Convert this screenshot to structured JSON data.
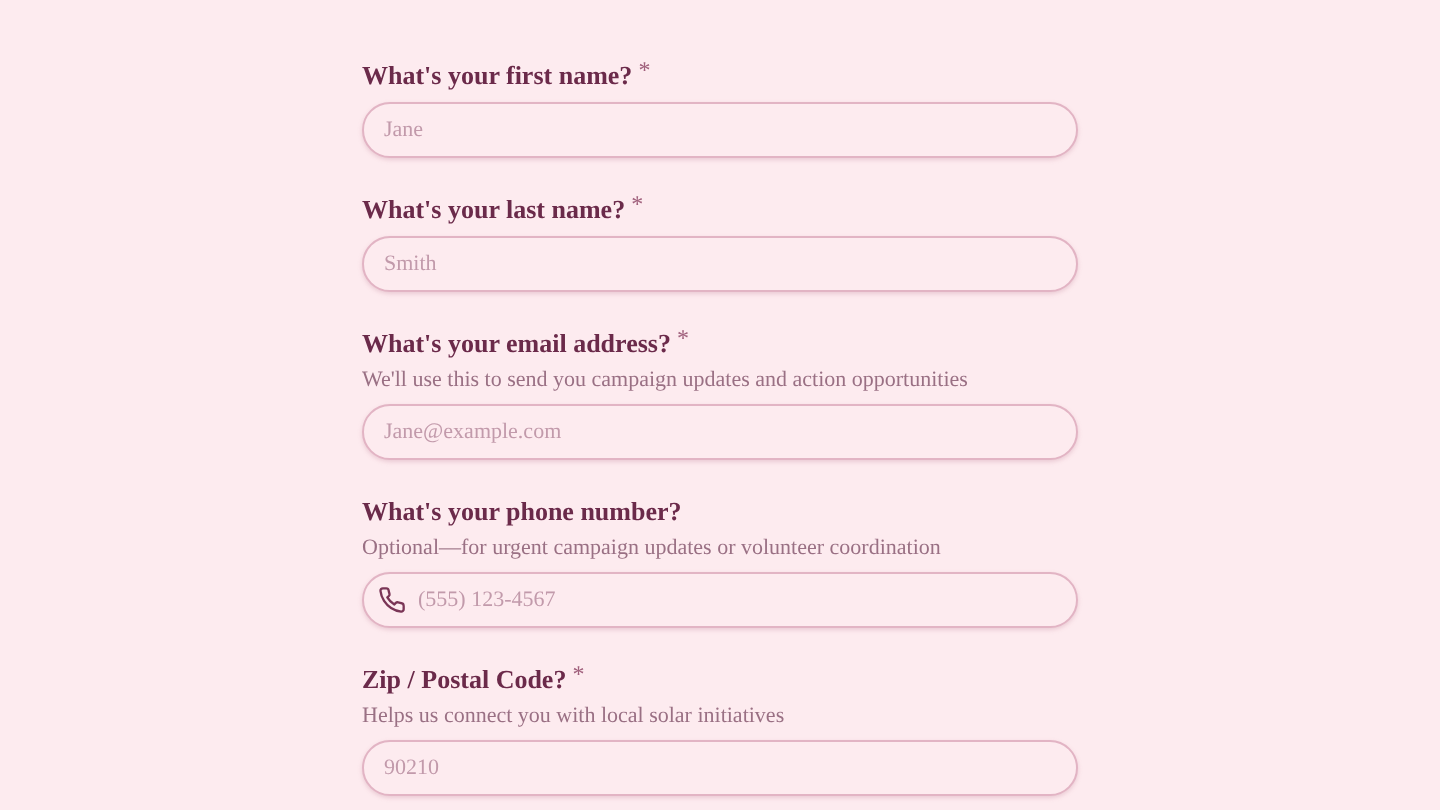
{
  "fields": [
    {
      "label": "What's your first name?",
      "required_mark": "*",
      "placeholder": "Jane"
    },
    {
      "label": "What's your last name?",
      "required_mark": "*",
      "placeholder": "Smith"
    },
    {
      "label": "What's your email address?",
      "required_mark": "*",
      "hint": "We'll use this to send you campaign updates and action opportunities",
      "placeholder": "Jane@example.com"
    },
    {
      "label": "What's your phone number?",
      "hint": "Optional—for urgent campaign updates or volunteer coordination",
      "placeholder": "(555) 123-4567",
      "kind": "phone"
    },
    {
      "label": "Zip / Postal Code?",
      "required_mark": "*",
      "hint": "Helps us connect you with local solar initiatives",
      "placeholder": "90210"
    }
  ]
}
